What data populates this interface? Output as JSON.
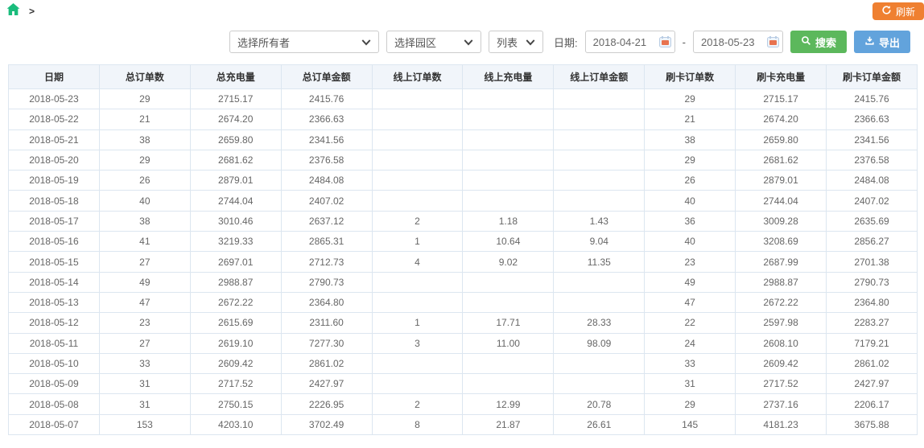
{
  "topbar": {
    "breadcrumb_arrow": ">",
    "refresh_label": "刷新"
  },
  "filters": {
    "owner_select_value": "选择所有者",
    "park_select_value": "选择园区",
    "view_select_value": "列表",
    "date_label": "日期:",
    "date_start": "2018-04-21",
    "date_separator": "-",
    "date_end": "2018-05-23",
    "search_label": "搜索",
    "export_label": "导出"
  },
  "colors": {
    "home_green": "#1abc7c",
    "refresh_orange": "#ef8031",
    "search_green": "#5cb85c",
    "export_blue": "#62a3dc",
    "table_header_bg": "#f1f5fa",
    "table_border": "#dce6f0"
  },
  "icons": {
    "home": "home-icon",
    "refresh": "refresh-icon",
    "chevron": "chevron-down-icon",
    "calendar": "calendar-icon",
    "search": "search-icon",
    "export": "download-icon"
  },
  "table": {
    "columns": [
      "日期",
      "总订单数",
      "总充电量",
      "总订单金额",
      "线上订单数",
      "线上充电量",
      "线上订单金额",
      "刷卡订单数",
      "刷卡充电量",
      "刷卡订单金额"
    ],
    "rows": [
      [
        "2018-05-23",
        "29",
        "2715.17",
        "2415.76",
        "",
        "",
        "",
        "29",
        "2715.17",
        "2415.76"
      ],
      [
        "2018-05-22",
        "21",
        "2674.20",
        "2366.63",
        "",
        "",
        "",
        "21",
        "2674.20",
        "2366.63"
      ],
      [
        "2018-05-21",
        "38",
        "2659.80",
        "2341.56",
        "",
        "",
        "",
        "38",
        "2659.80",
        "2341.56"
      ],
      [
        "2018-05-20",
        "29",
        "2681.62",
        "2376.58",
        "",
        "",
        "",
        "29",
        "2681.62",
        "2376.58"
      ],
      [
        "2018-05-19",
        "26",
        "2879.01",
        "2484.08",
        "",
        "",
        "",
        "26",
        "2879.01",
        "2484.08"
      ],
      [
        "2018-05-18",
        "40",
        "2744.04",
        "2407.02",
        "",
        "",
        "",
        "40",
        "2744.04",
        "2407.02"
      ],
      [
        "2018-05-17",
        "38",
        "3010.46",
        "2637.12",
        "2",
        "1.18",
        "1.43",
        "36",
        "3009.28",
        "2635.69"
      ],
      [
        "2018-05-16",
        "41",
        "3219.33",
        "2865.31",
        "1",
        "10.64",
        "9.04",
        "40",
        "3208.69",
        "2856.27"
      ],
      [
        "2018-05-15",
        "27",
        "2697.01",
        "2712.73",
        "4",
        "9.02",
        "11.35",
        "23",
        "2687.99",
        "2701.38"
      ],
      [
        "2018-05-14",
        "49",
        "2988.87",
        "2790.73",
        "",
        "",
        "",
        "49",
        "2988.87",
        "2790.73"
      ],
      [
        "2018-05-13",
        "47",
        "2672.22",
        "2364.80",
        "",
        "",
        "",
        "47",
        "2672.22",
        "2364.80"
      ],
      [
        "2018-05-12",
        "23",
        "2615.69",
        "2311.60",
        "1",
        "17.71",
        "28.33",
        "22",
        "2597.98",
        "2283.27"
      ],
      [
        "2018-05-11",
        "27",
        "2619.10",
        "7277.30",
        "3",
        "11.00",
        "98.09",
        "24",
        "2608.10",
        "7179.21"
      ],
      [
        "2018-05-10",
        "33",
        "2609.42",
        "2861.02",
        "",
        "",
        "",
        "33",
        "2609.42",
        "2861.02"
      ],
      [
        "2018-05-09",
        "31",
        "2717.52",
        "2427.97",
        "",
        "",
        "",
        "31",
        "2717.52",
        "2427.97"
      ],
      [
        "2018-05-08",
        "31",
        "2750.15",
        "2226.95",
        "2",
        "12.99",
        "20.78",
        "29",
        "2737.16",
        "2206.17"
      ],
      [
        "2018-05-07",
        "153",
        "4203.10",
        "3702.49",
        "8",
        "21.87",
        "26.61",
        "145",
        "4181.23",
        "3675.88"
      ]
    ]
  }
}
